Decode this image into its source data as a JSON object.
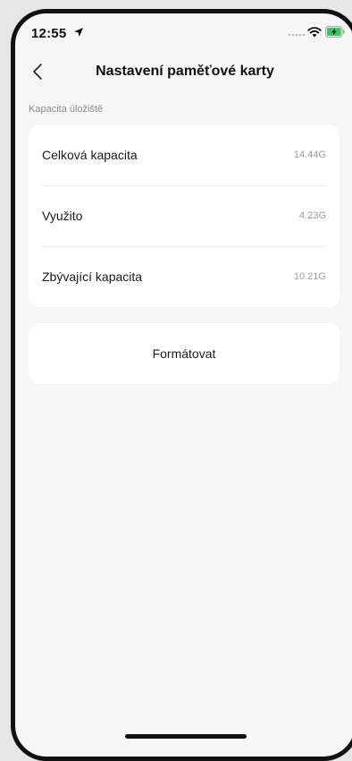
{
  "status_bar": {
    "time": "12:55",
    "icons": [
      "location-arrow-icon",
      "signal-icon",
      "wifi-icon",
      "battery-charging-icon"
    ]
  },
  "nav": {
    "back_icon": "chevron-left-icon",
    "title": "Nastavení paměťové karty"
  },
  "storage": {
    "section_label": "Kapacita úložiště",
    "rows": [
      {
        "label": "Celková kapacita",
        "value": "14.44G"
      },
      {
        "label": "Využito",
        "value": "4.23G"
      },
      {
        "label": "Zbývající kapacita",
        "value": "10.21G"
      }
    ]
  },
  "actions": {
    "format_label": "Formátovat"
  },
  "colors": {
    "background": "#f6f6f6",
    "card": "#ffffff",
    "battery": "#34c759"
  }
}
